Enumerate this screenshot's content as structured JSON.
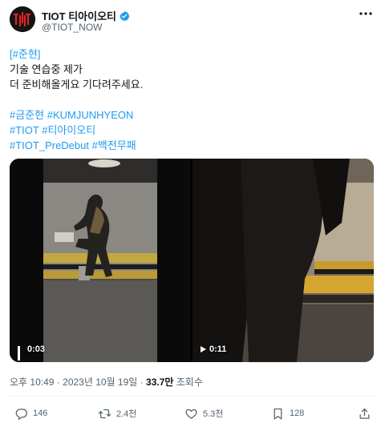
{
  "author": {
    "display_name": "TIOT 티아이오티",
    "handle": "@TIOT_NOW",
    "avatar_icon": "tiot-logo-icon",
    "verified_color": "#1d9bf0"
  },
  "tweet": {
    "lines": [
      {
        "hashtag": "#준현",
        "pre": "[",
        "post": "]"
      },
      {
        "text": "기술 연습중 제가"
      },
      {
        "text": "더 준비해올게요 기다려주세요."
      }
    ],
    "hashtag_lines": [
      [
        "#금준현",
        "#KUMJUNHYEON"
      ],
      [
        "#TIOT",
        "#티아이오티"
      ],
      [
        "#TIOT_PreDebut",
        "#백전무패"
      ]
    ]
  },
  "media": {
    "video_left": {
      "state": "playing",
      "time": "0:03"
    },
    "video_right": {
      "state": "paused",
      "time": "0:11"
    }
  },
  "meta": {
    "time": "오후 10:49",
    "separator": "·",
    "date": "2023년 10월 19일",
    "views_count": "33.7만",
    "views_label": "조회수"
  },
  "actions": {
    "replies": "146",
    "retweets": "2.4천",
    "likes": "5.3천",
    "bookmarks": "128"
  },
  "colors": {
    "text": "#0f1419",
    "secondary": "#536471",
    "link": "#1d9bf0"
  }
}
